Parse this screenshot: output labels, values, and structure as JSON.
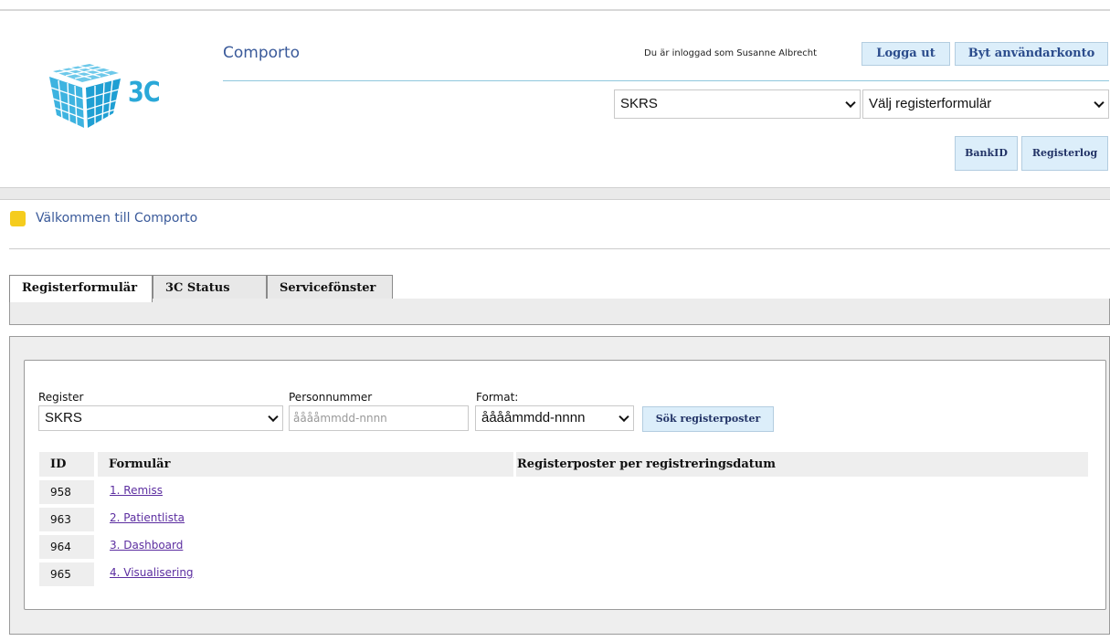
{
  "header": {
    "app_title": "Comporto",
    "logo_text": "3C",
    "logged_in_text": "Du är inloggad som Susanne Albrecht",
    "logout_label": "Logga ut",
    "switch_account_label": "Byt användarkonto",
    "register_select_value": "SKRS",
    "form_select_value": "Välj registerformulär",
    "bankid_label": "BankID",
    "registerlog_label": "Registerlog"
  },
  "welcome": {
    "text": "Välkommen till Comporto",
    "color": "#f5cc1d"
  },
  "tabs": [
    {
      "label": "Registerformulär",
      "active": true
    },
    {
      "label": "3C Status",
      "active": false
    },
    {
      "label": "Servicefönster",
      "active": false
    }
  ],
  "search": {
    "register_label": "Register",
    "register_value": "SKRS",
    "pnr_label": "Personnummer",
    "pnr_placeholder": "ååååmmdd-nnnn",
    "format_label": "Format:",
    "format_value": "ååååmmdd-nnnn",
    "search_button_label": "Sök registerposter"
  },
  "table": {
    "headers": [
      "ID",
      "Formulär",
      "Registerposter per registreringsdatum"
    ],
    "rows": [
      {
        "id": "958",
        "form": "1. Remiss"
      },
      {
        "id": "963",
        "form": "2. Patientlista"
      },
      {
        "id": "964",
        "form": "3. Dashboard"
      },
      {
        "id": "965",
        "form": "4. Visualisering"
      }
    ]
  },
  "colors": {
    "accent": "#2aa8d8",
    "link": "#5c2ea0",
    "button_bg": "#dceefa"
  }
}
